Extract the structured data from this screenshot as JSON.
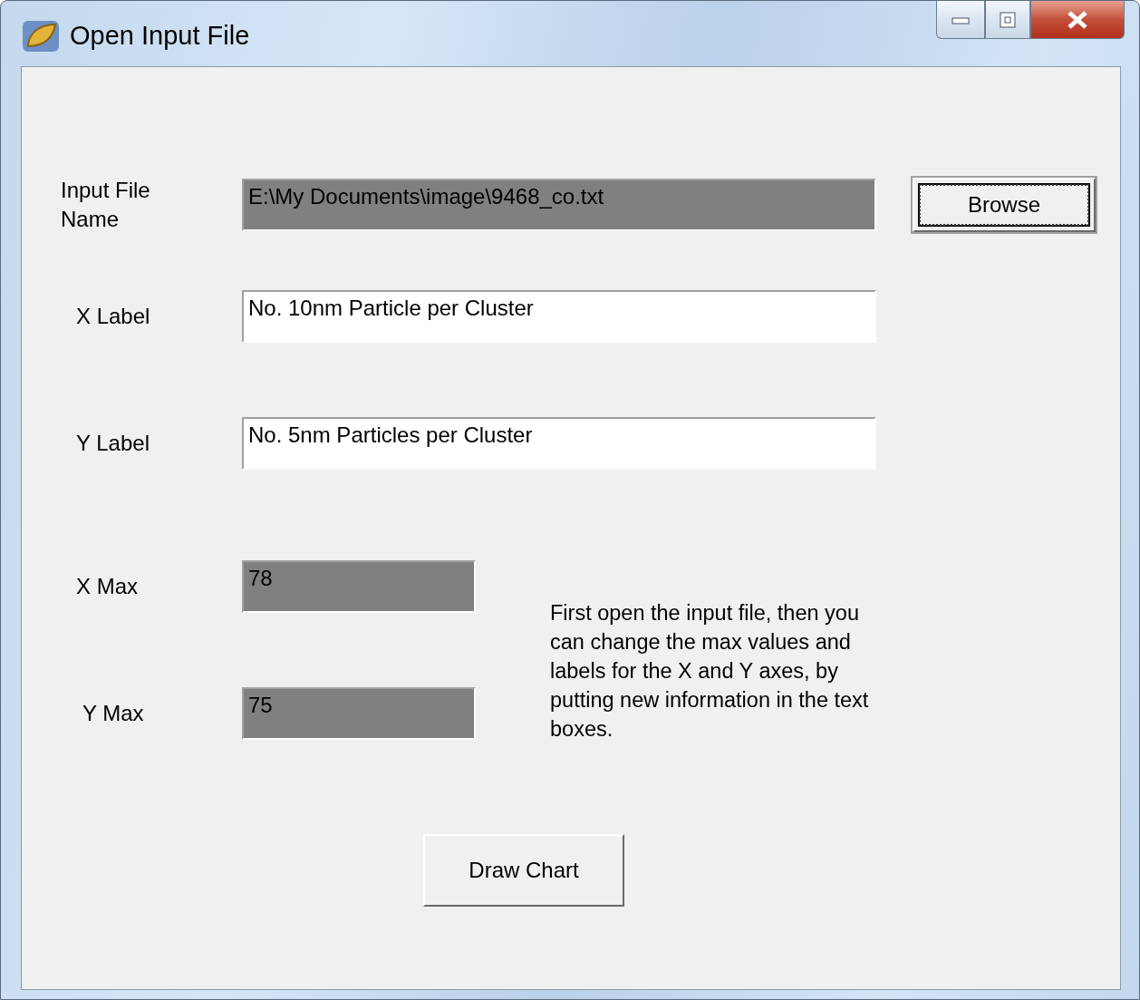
{
  "window": {
    "title": "Open Input File"
  },
  "file_field": {
    "label": "Input File Name",
    "value": "E:\\My Documents\\image\\9468_co.txt",
    "disabled": true
  },
  "browse_button": {
    "label": "Browse",
    "focused": true
  },
  "label_fields": [
    {
      "label": "X Label",
      "value": "No. 10nm Particle per Cluster",
      "disabled": false
    },
    {
      "label": "Y Label",
      "value": "No. 5nm Particles per Cluster",
      "disabled": false
    }
  ],
  "max_fields": [
    {
      "label": "X Max",
      "value": "78",
      "disabled": true
    },
    {
      "label": "Y Max",
      "value": "75",
      "disabled": true
    }
  ],
  "help_text": "First open the input file, then you can change the max values and labels for the X and Y axes, by putting new information in the text boxes.",
  "draw_button": {
    "label": "Draw Chart"
  }
}
